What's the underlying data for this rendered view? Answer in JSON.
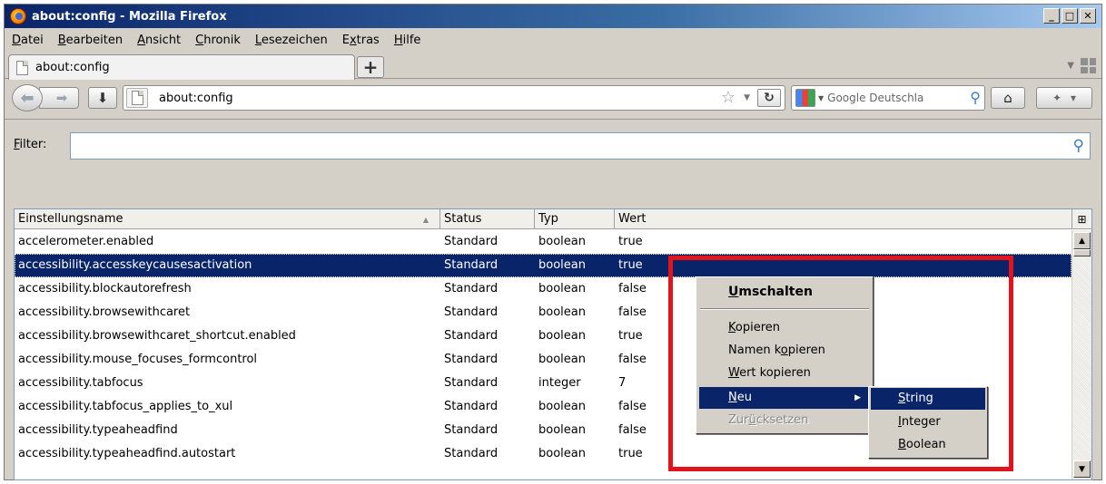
{
  "window": {
    "title": "about:config - Mozilla Firefox",
    "buttons": {
      "minimize": "_",
      "maximize": "□",
      "close": "✕"
    }
  },
  "menubar": [
    {
      "pre": "",
      "u": "D",
      "post": "atei"
    },
    {
      "pre": "",
      "u": "B",
      "post": "earbeiten"
    },
    {
      "pre": "",
      "u": "A",
      "post": "nsicht"
    },
    {
      "pre": "",
      "u": "C",
      "post": "hronik"
    },
    {
      "pre": "",
      "u": "L",
      "post": "esezeichen"
    },
    {
      "pre": "E",
      "u": "x",
      "post": "tras"
    },
    {
      "pre": "",
      "u": "H",
      "post": "ilfe"
    }
  ],
  "tabs": [
    {
      "label": "about:config"
    }
  ],
  "newtab_label": "+",
  "navbar": {
    "url": "about:config",
    "search_placeholder": "Google Deutschla"
  },
  "filter": {
    "label_u": "F",
    "label_rest": "ilter:",
    "value": ""
  },
  "table": {
    "columns": [
      "Einstellungsname",
      "Status",
      "Typ",
      "Wert"
    ],
    "rows": [
      [
        "accelerometer.enabled",
        "Standard",
        "boolean",
        "true"
      ],
      [
        "accessibility.accesskeycausesactivation",
        "Standard",
        "boolean",
        "true"
      ],
      [
        "accessibility.blockautorefresh",
        "Standard",
        "boolean",
        "false"
      ],
      [
        "accessibility.browsewithcaret",
        "Standard",
        "boolean",
        "false"
      ],
      [
        "accessibility.browsewithcaret_shortcut.enabled",
        "Standard",
        "boolean",
        "true"
      ],
      [
        "accessibility.mouse_focuses_formcontrol",
        "Standard",
        "boolean",
        "false"
      ],
      [
        "accessibility.tabfocus",
        "Standard",
        "integer",
        "7"
      ],
      [
        "accessibility.tabfocus_applies_to_xul",
        "Standard",
        "boolean",
        "false"
      ],
      [
        "accessibility.typeaheadfind",
        "Standard",
        "boolean",
        "false"
      ],
      [
        "accessibility.typeaheadfind.autostart",
        "Standard",
        "boolean",
        "true"
      ]
    ],
    "selected_row": 1
  },
  "context_menu": {
    "toggle": {
      "pre": "",
      "u": "U",
      "post": "mschalten"
    },
    "copy": {
      "pre": "",
      "u": "K",
      "post": "opieren"
    },
    "copy_name": {
      "pre": "Namen k",
      "u": "o",
      "post": "pieren"
    },
    "copy_value": {
      "pre": "",
      "u": "W",
      "post": "ert kopieren"
    },
    "new": {
      "pre": "",
      "u": "N",
      "post": "eu"
    },
    "reset": {
      "pre": "Zur",
      "u": "ü",
      "post": "cksetzen"
    }
  },
  "submenu": {
    "string": {
      "u": "S",
      "post": "tring"
    },
    "integer": {
      "u": "I",
      "post": "nteger"
    },
    "boolean": {
      "u": "B",
      "post": "oolean"
    }
  },
  "colors": {
    "selection": "#0a246a",
    "highlight_box": "#e0141c"
  }
}
